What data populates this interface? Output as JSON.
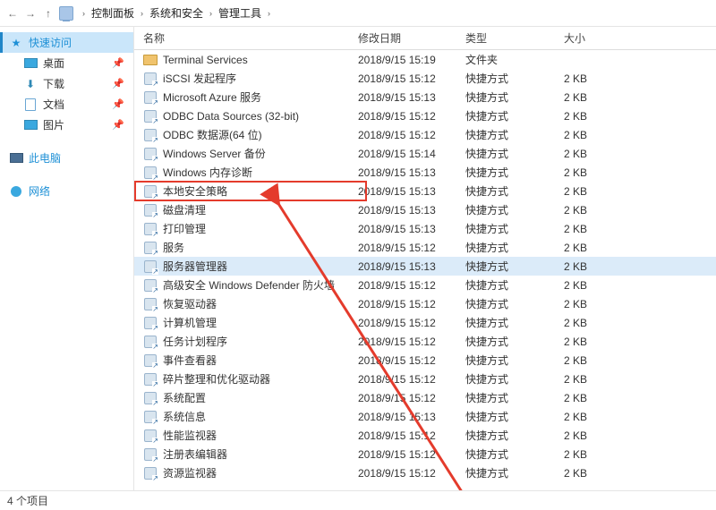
{
  "breadcrumb": {
    "back": "←",
    "fwd": "→",
    "up": "↑",
    "items": [
      "控制面板",
      "系统和安全",
      "管理工具"
    ]
  },
  "sidebar": {
    "quick": {
      "label": "快速访问",
      "items": [
        {
          "label": "桌面"
        },
        {
          "label": "下载"
        },
        {
          "label": "文档"
        },
        {
          "label": "图片"
        }
      ]
    },
    "thispc": {
      "label": "此电脑"
    },
    "network": {
      "label": "网络"
    }
  },
  "columns": {
    "name": "名称",
    "date": "修改日期",
    "type": "类型",
    "size": "大小"
  },
  "rows": [
    {
      "icon": "folder",
      "name": "Terminal Services",
      "date": "2018/9/15 15:19",
      "type": "文件夹",
      "size": ""
    },
    {
      "icon": "lnk",
      "name": "iSCSI 发起程序",
      "date": "2018/9/15 15:12",
      "type": "快捷方式",
      "size": "2 KB"
    },
    {
      "icon": "lnk",
      "name": "Microsoft Azure 服务",
      "date": "2018/9/15 15:13",
      "type": "快捷方式",
      "size": "2 KB"
    },
    {
      "icon": "lnk",
      "name": "ODBC Data Sources (32-bit)",
      "date": "2018/9/15 15:12",
      "type": "快捷方式",
      "size": "2 KB"
    },
    {
      "icon": "lnk",
      "name": "ODBC 数据源(64 位)",
      "date": "2018/9/15 15:12",
      "type": "快捷方式",
      "size": "2 KB"
    },
    {
      "icon": "lnk",
      "name": "Windows Server 备份",
      "date": "2018/9/15 15:14",
      "type": "快捷方式",
      "size": "2 KB"
    },
    {
      "icon": "lnk",
      "name": "Windows 内存诊断",
      "date": "2018/9/15 15:13",
      "type": "快捷方式",
      "size": "2 KB"
    },
    {
      "icon": "lnk",
      "name": "本地安全策略",
      "hl": true,
      "date": "2018/9/15 15:13",
      "type": "快捷方式",
      "size": "2 KB"
    },
    {
      "icon": "lnk",
      "name": "磁盘清理",
      "date": "2018/9/15 15:13",
      "type": "快捷方式",
      "size": "2 KB"
    },
    {
      "icon": "lnk",
      "name": "打印管理",
      "date": "2018/9/15 15:13",
      "type": "快捷方式",
      "size": "2 KB"
    },
    {
      "icon": "lnk",
      "name": "服务",
      "date": "2018/9/15 15:12",
      "type": "快捷方式",
      "size": "2 KB"
    },
    {
      "icon": "lnk",
      "name": "服务器管理器",
      "sel": true,
      "date": "2018/9/15 15:13",
      "type": "快捷方式",
      "size": "2 KB"
    },
    {
      "icon": "lnk",
      "name": "高级安全 Windows Defender 防火墙",
      "date": "2018/9/15 15:12",
      "type": "快捷方式",
      "size": "2 KB"
    },
    {
      "icon": "lnk",
      "name": "恢复驱动器",
      "date": "2018/9/15 15:12",
      "type": "快捷方式",
      "size": "2 KB"
    },
    {
      "icon": "lnk",
      "name": "计算机管理",
      "date": "2018/9/15 15:12",
      "type": "快捷方式",
      "size": "2 KB"
    },
    {
      "icon": "lnk",
      "name": "任务计划程序",
      "date": "2018/9/15 15:12",
      "type": "快捷方式",
      "size": "2 KB"
    },
    {
      "icon": "lnk",
      "name": "事件查看器",
      "date": "2018/9/15 15:12",
      "type": "快捷方式",
      "size": "2 KB"
    },
    {
      "icon": "lnk",
      "name": "碎片整理和优化驱动器",
      "date": "2018/9/15 15:12",
      "type": "快捷方式",
      "size": "2 KB"
    },
    {
      "icon": "lnk",
      "name": "系统配置",
      "date": "2018/9/15 15:12",
      "type": "快捷方式",
      "size": "2 KB"
    },
    {
      "icon": "lnk",
      "name": "系统信息",
      "date": "2018/9/15 15:13",
      "type": "快捷方式",
      "size": "2 KB"
    },
    {
      "icon": "lnk",
      "name": "性能监视器",
      "date": "2018/9/15 15:12",
      "type": "快捷方式",
      "size": "2 KB"
    },
    {
      "icon": "lnk",
      "name": "注册表编辑器",
      "date": "2018/9/15 15:12",
      "type": "快捷方式",
      "size": "2 KB"
    },
    {
      "icon": "lnk",
      "name": "资源监视器",
      "date": "2018/9/15 15:12",
      "type": "快捷方式",
      "size": "2 KB"
    }
  ],
  "status": "4 个项目",
  "highlight_color": "#e43b2c"
}
